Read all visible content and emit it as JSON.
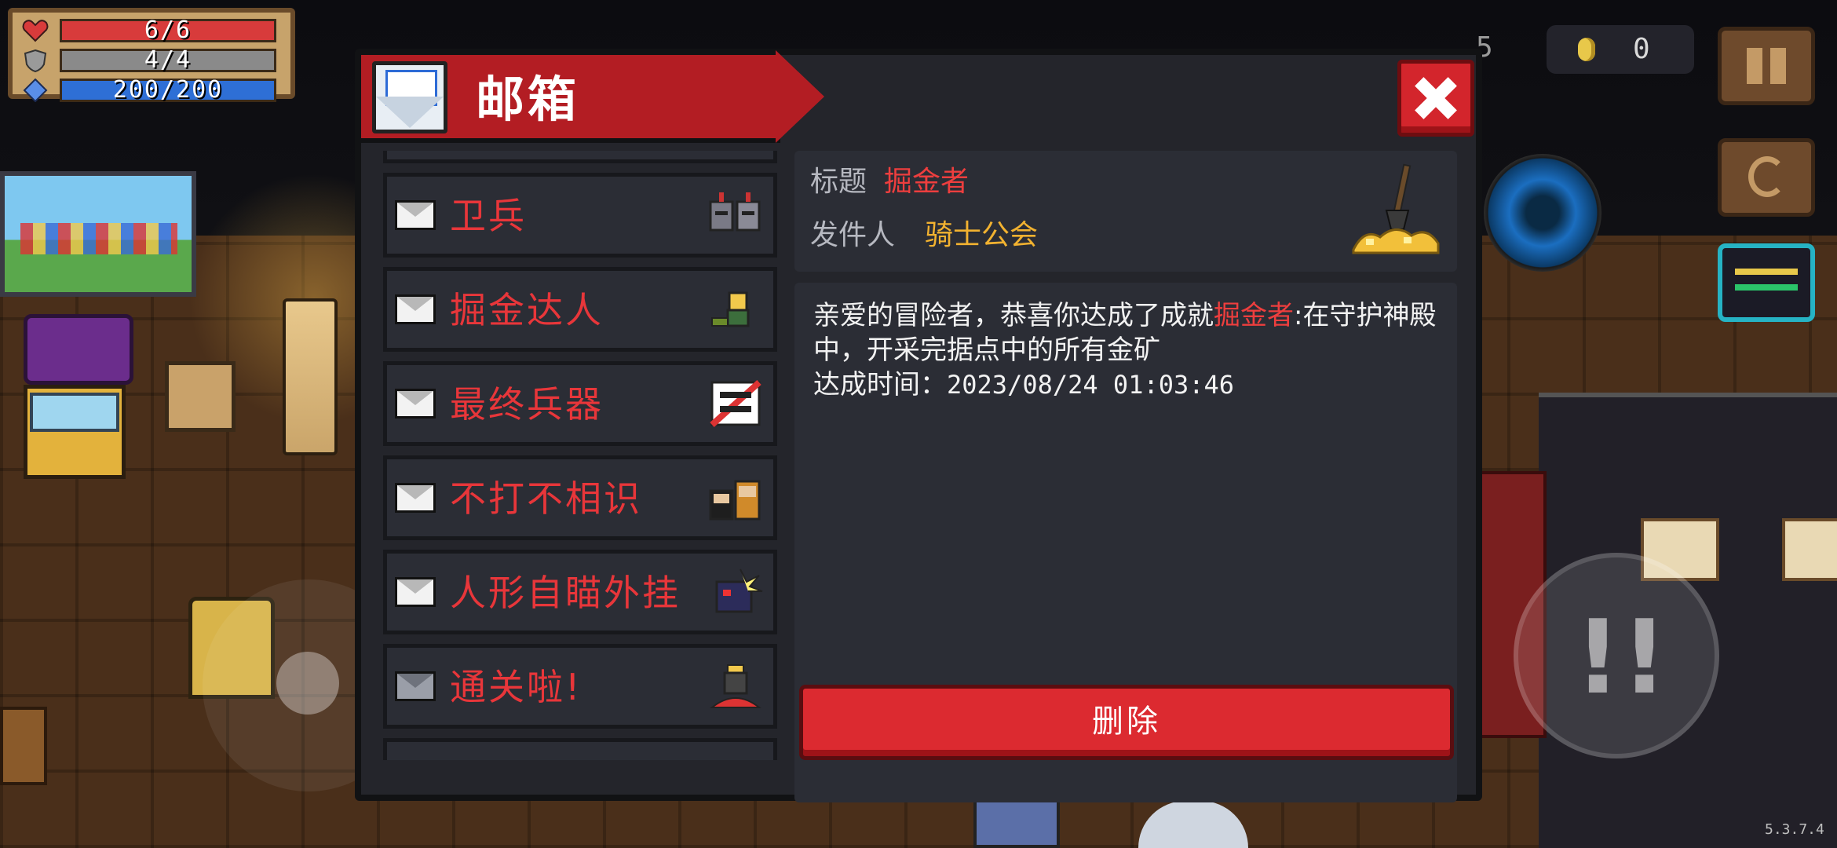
{
  "hud": {
    "health": {
      "text": "6/6",
      "level": 1.0,
      "color": "#d83b3b"
    },
    "armor": {
      "text": "4/4",
      "level": 1.0,
      "color": "#8a8a8a"
    },
    "energy": {
      "text": "200/200",
      "level": 1.0,
      "color": "#2e6fd6"
    },
    "coins": "0",
    "partial_counter": "5",
    "version": "5.3.7.4"
  },
  "mailbox": {
    "title": "邮箱",
    "header_icon_text": "C.R MAIL",
    "items": [
      {
        "label": "卫兵",
        "read": false,
        "thumb": "knight-helmets-icon"
      },
      {
        "label": "掘金达人",
        "read": false,
        "thumb": "miner-character-icon"
      },
      {
        "label": "最终兵器",
        "read": false,
        "thumb": "final-weapon-badge-icon"
      },
      {
        "label": "不打不相识",
        "read": false,
        "thumb": "duo-characters-icon"
      },
      {
        "label": "人形自瞄外挂",
        "read": false,
        "thumb": "aimbot-robot-icon"
      },
      {
        "label": "通关啦!",
        "read": true,
        "thumb": "trophy-character-icon"
      }
    ],
    "detail": {
      "title_label": "标题",
      "title_value": "掘金者",
      "sender_label": "发件人",
      "sender_value": "骑士公会",
      "body_prefix": "亲爱的冒险者，恭喜你达成了成就",
      "body_highlight": "掘金者",
      "body_suffix": ":在守护神殿中，开采完据点中的所有金矿",
      "time_label": "达成时间：",
      "time_value": "2023/08/24 01:03:46",
      "thumb": "shovel-gold-pile-icon"
    },
    "delete_label": "删除"
  }
}
